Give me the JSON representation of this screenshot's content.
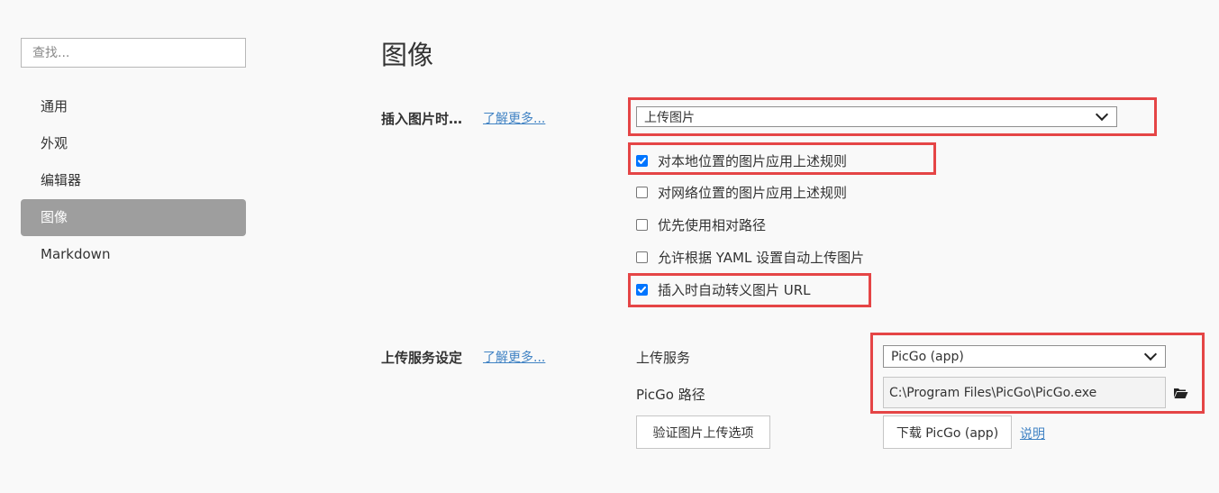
{
  "sidebar": {
    "search_placeholder": "查找...",
    "items": [
      {
        "label": "通用"
      },
      {
        "label": "外观"
      },
      {
        "label": "编辑器"
      },
      {
        "label": "图像"
      },
      {
        "label": "Markdown"
      }
    ],
    "active_item": "图像"
  },
  "page": {
    "title": "图像"
  },
  "insert_section": {
    "label": "插入图片时…",
    "learn_more": "了解更多...",
    "select_value": "上传图片",
    "options": [
      {
        "label": "对本地位置的图片应用上述规则",
        "checked": true
      },
      {
        "label": "对网络位置的图片应用上述规则",
        "checked": false
      },
      {
        "label": "优先使用相对路径",
        "checked": false
      },
      {
        "label": "允许根据 YAML 设置自动上传图片",
        "checked": false
      },
      {
        "label": "插入时自动转义图片 URL",
        "checked": true
      }
    ]
  },
  "upload_section": {
    "label": "上传服务设定",
    "learn_more": "了解更多...",
    "service_label": "上传服务",
    "service_value": "PicGo (app)",
    "path_label": "PicGo 路径",
    "path_value": "C:\\Program Files\\PicGo\\PicGo.exe",
    "verify_button": "验证图片上传选项",
    "download_button": "下载 PicGo (app)",
    "help_link": "说明"
  },
  "colors": {
    "highlight": "#e54546",
    "active_nav": "#9e9e9e",
    "link": "#4183c4",
    "checkbox": "#0075ff"
  }
}
